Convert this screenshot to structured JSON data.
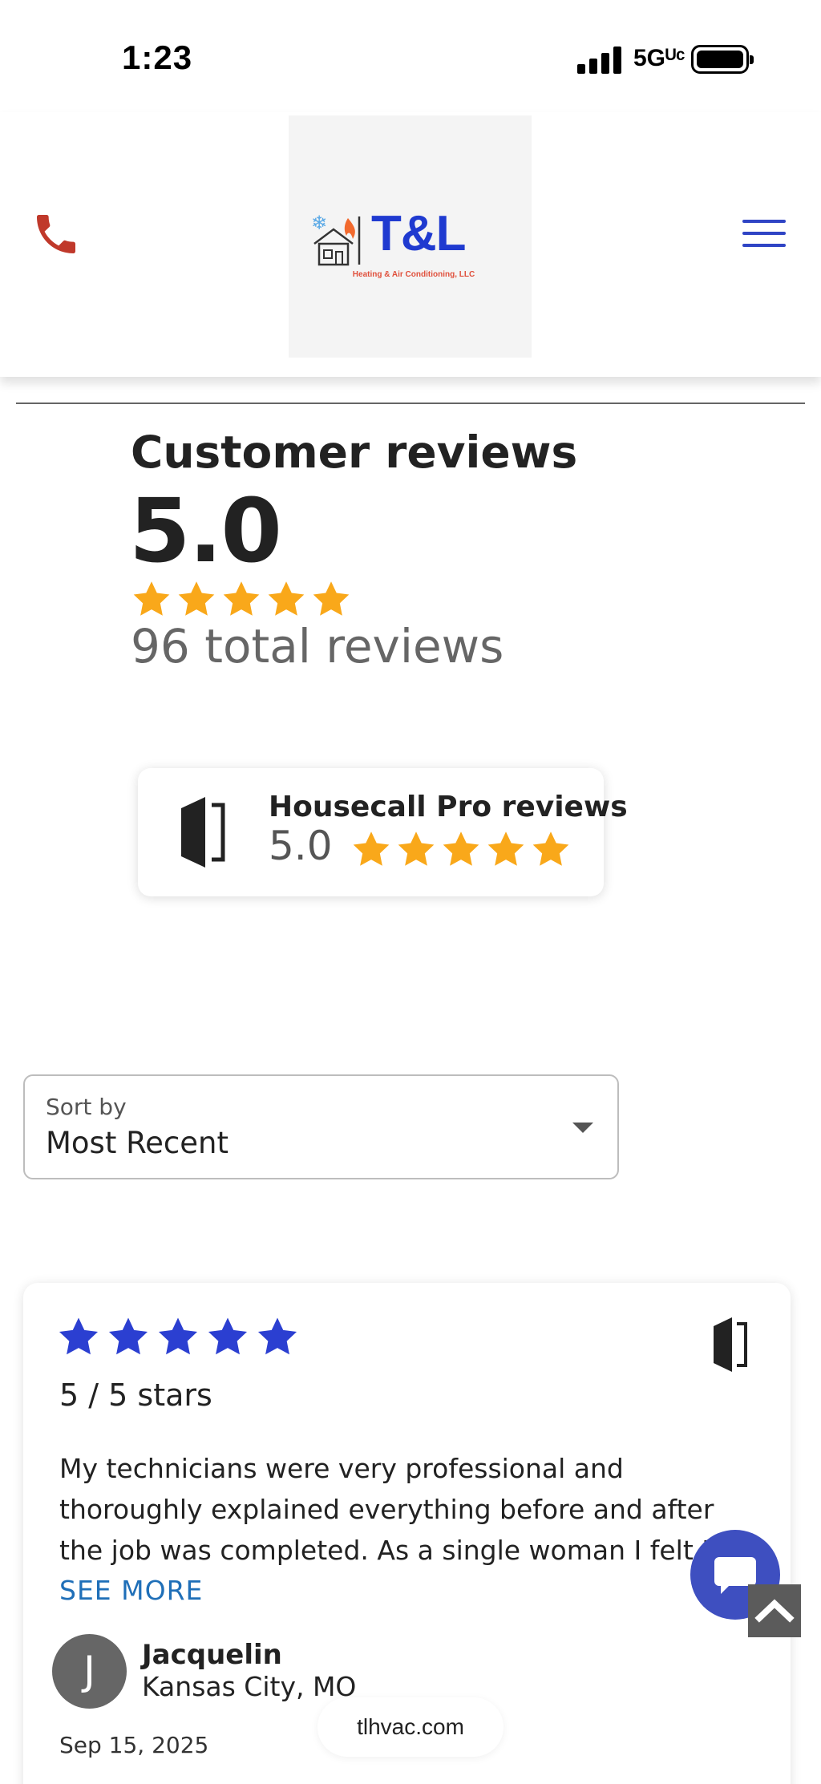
{
  "status_bar": {
    "time": "1:23",
    "network": "5Gᵁᶜ"
  },
  "header": {
    "logo_text": "T&L",
    "logo_subtitle": "Heating & Air Conditioning, LLC",
    "phone_icon": "phone-icon",
    "menu_icon": "hamburger-menu-icon",
    "brand_color": "#1f3ad0",
    "accent_color": "#c0392b"
  },
  "summary": {
    "title": "Customer reviews",
    "rating": "5.0",
    "stars": 5,
    "star_color": "#f9a81a",
    "total_reviews": "96 total reviews"
  },
  "source_card": {
    "title": "Housecall Pro reviews",
    "rating": "5.0",
    "stars": 5,
    "logo_icon": "housecall-pro-logo-icon"
  },
  "sort": {
    "label": "Sort by",
    "value": "Most Recent"
  },
  "review": {
    "stars": 5,
    "star_color": "#2b3fd1",
    "score_text": "5 / 5 stars",
    "text": "My technicians were very professional and thoroughly explained everything before and after the job was completed. As a single woman I felt I could trust them",
    "see_more": "SEE MORE",
    "avatar_initial": "J",
    "reviewer_name": "Jacquelin",
    "reviewer_location": "Kansas City, MO",
    "date": "Sep 15, 2025",
    "source_icon": "housecall-pro-logo-icon"
  },
  "overlays": {
    "chat_icon": "chat-bubble-icon",
    "scroll_top_icon": "chevron-up-icon",
    "url": "tlhvac.com"
  }
}
